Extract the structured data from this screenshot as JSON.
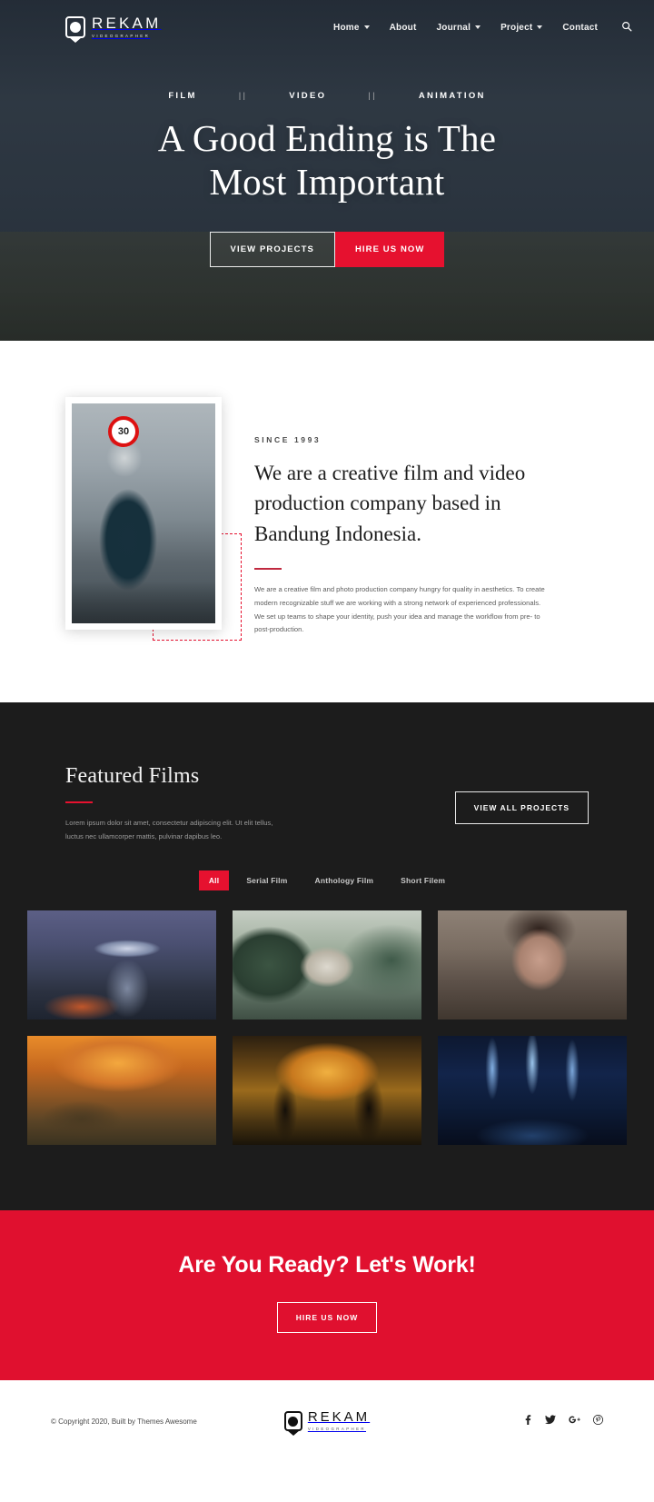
{
  "brand": {
    "name": "REKAM",
    "tagline": "VIDEOGRAPHER"
  },
  "nav": {
    "items": [
      {
        "label": "Home",
        "has_dropdown": true
      },
      {
        "label": "About",
        "has_dropdown": false
      },
      {
        "label": "Journal",
        "has_dropdown": true
      },
      {
        "label": "Project",
        "has_dropdown": true
      },
      {
        "label": "Contact",
        "has_dropdown": false
      }
    ],
    "search_icon": "search-icon"
  },
  "hero": {
    "tags": [
      "FILM",
      "VIDEO",
      "ANIMATION"
    ],
    "separator": "||",
    "title_line1": "A Good Ending is The",
    "title_line2": "Most Important",
    "primary_button": "VIEW PROJECTS",
    "secondary_button": "HIRE US NOW"
  },
  "about": {
    "eyebrow": "SINCE 1993",
    "heading": "We are a creative film and video production company based in Bandung Indonesia.",
    "paragraph": "We are a creative film and photo production company hungry for quality in aesthetics. To create modern recognizable stuff we are working with a strong network of experienced professionals. We set up teams to shape your identity, push your idea and manage the workflow from pre- to post-production."
  },
  "featured": {
    "title": "Featured Films",
    "paragraph": "Lorem ipsum dolor sit amet, consectetur adipiscing elit. Ut elit tellus, luctus nec ullamcorper mattis, pulvinar dapibus leo.",
    "view_all_button": "VIEW ALL PROJECTS",
    "filters": [
      {
        "label": "All",
        "active": true
      },
      {
        "label": "Serial Film",
        "active": false
      },
      {
        "label": "Anthology Film",
        "active": false
      },
      {
        "label": "Short Filem",
        "active": false
      }
    ],
    "items": [
      {
        "name": "ufo-abduction-film"
      },
      {
        "name": "wolf-forest-film"
      },
      {
        "name": "portrait-drama-film"
      },
      {
        "name": "medieval-battle-film"
      },
      {
        "name": "war-soldiers-film"
      },
      {
        "name": "concert-lights-film"
      }
    ]
  },
  "cta": {
    "title": "Are You Ready? Let's Work!",
    "button": "HIRE US NOW"
  },
  "footer": {
    "copyright": "© Copyright 2020, Built by Themes Awesome",
    "socials": [
      {
        "name": "facebook",
        "glyph": "f"
      },
      {
        "name": "twitter",
        "glyph": "🐦"
      },
      {
        "name": "google-plus",
        "glyph": "G+"
      },
      {
        "name": "pinterest",
        "glyph": "P"
      }
    ]
  },
  "colors": {
    "accent_red": "#e6112f",
    "cta_red": "#e0102f",
    "dark_section": "#1c1c1c"
  }
}
